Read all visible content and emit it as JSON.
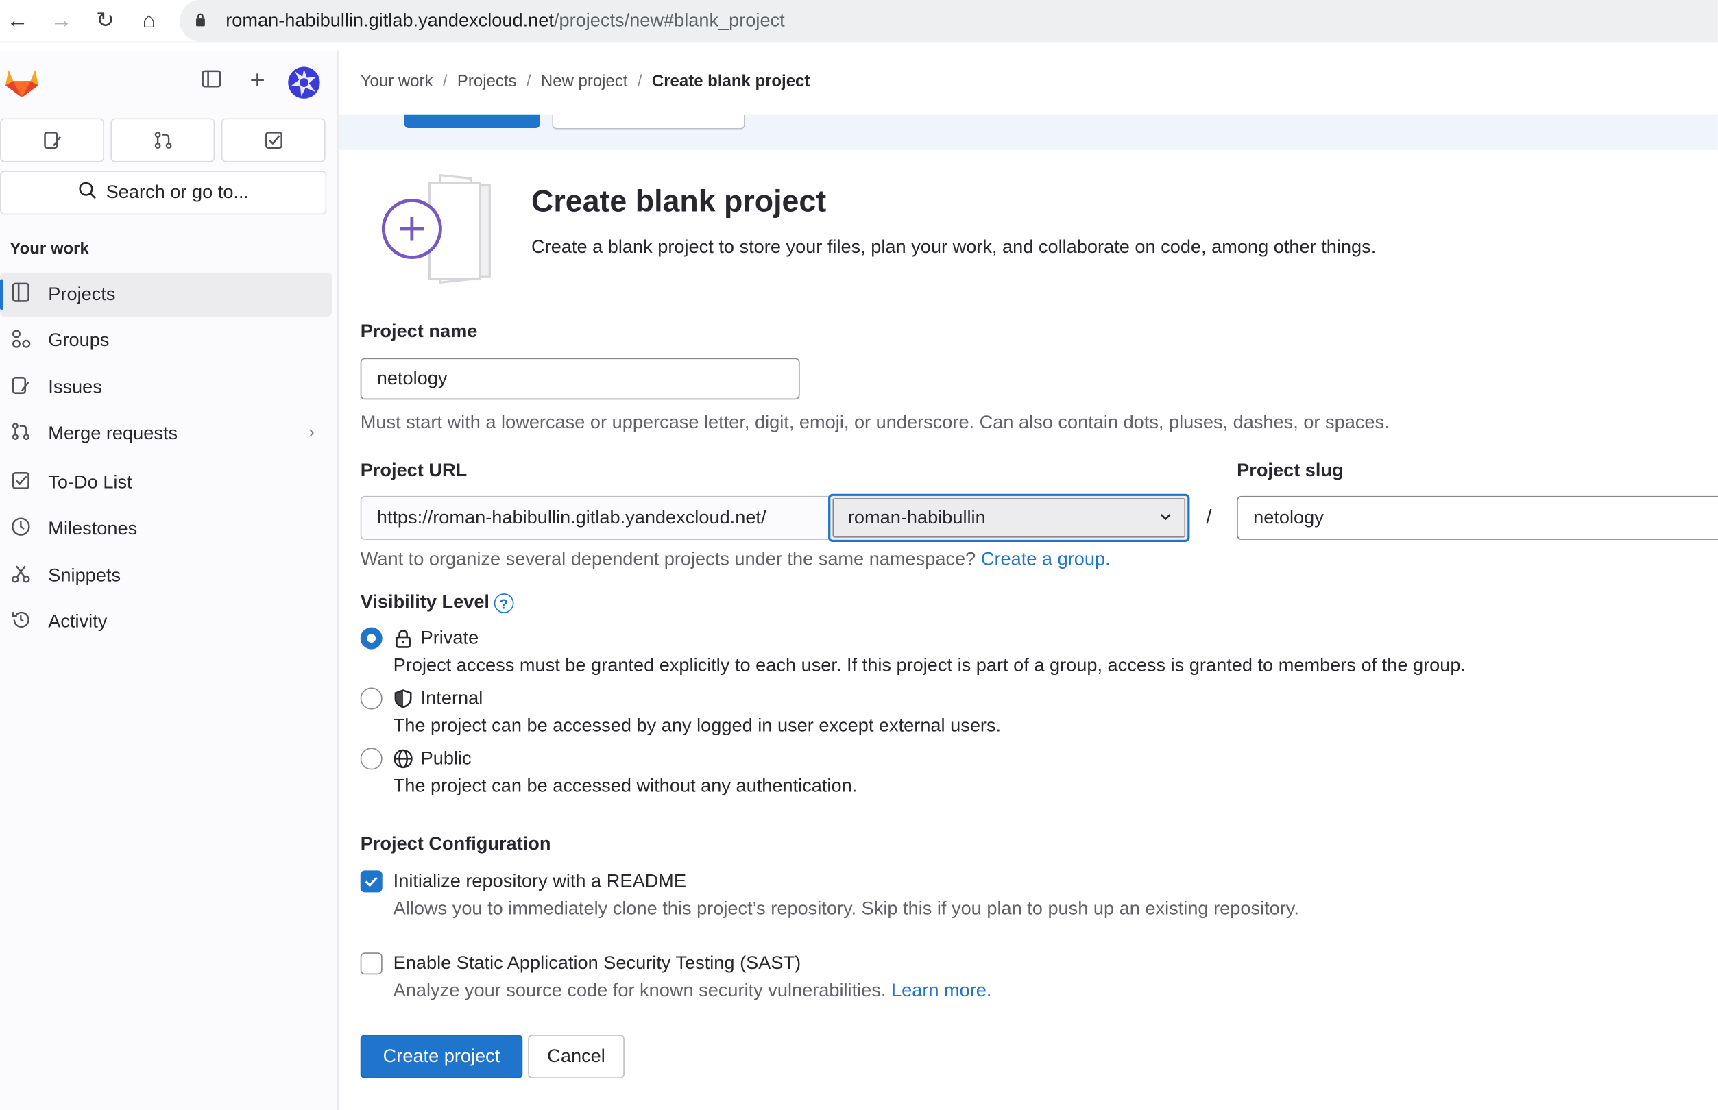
{
  "browser": {
    "url_host": "roman-habibullin.gitlab.yandexcloud.net",
    "url_path": "/projects/new#blank_project"
  },
  "sidebar": {
    "search_label": "Search or go to...",
    "section_title": "Your work",
    "items": [
      {
        "label": "Projects",
        "icon": "project-icon"
      },
      {
        "label": "Groups",
        "icon": "group-icon"
      },
      {
        "label": "Issues",
        "icon": "issues-icon"
      },
      {
        "label": "Merge requests",
        "icon": "merge-request-icon"
      },
      {
        "label": "To-Do List",
        "icon": "todo-icon"
      },
      {
        "label": "Milestones",
        "icon": "milestone-icon"
      },
      {
        "label": "Snippets",
        "icon": "snippet-icon"
      },
      {
        "label": "Activity",
        "icon": "history-icon"
      }
    ]
  },
  "breadcrumb": {
    "items": [
      "Your work",
      "Projects",
      "New project",
      "Create blank project"
    ]
  },
  "header": {
    "title": "Create blank project",
    "description": "Create a blank project to store your files, plan your work, and collaborate on code, among other things."
  },
  "form": {
    "project_name_label": "Project name",
    "project_name_value": "netology",
    "project_name_help": "Must start with a lowercase or uppercase letter, digit, emoji, or underscore. Can also contain dots, pluses, dashes, or spaces.",
    "project_url_label": "Project URL",
    "project_url_prefix": "https://roman-habibullin.gitlab.yandexcloud.net/",
    "namespace_value": "roman-habibullin",
    "slash": "/",
    "project_slug_label": "Project slug",
    "project_slug_value": "netology",
    "namespace_help": "Want to organize several dependent projects under the same namespace?",
    "namespace_help_link": "Create a group.",
    "visibility_label": "Visibility Level",
    "visibility_help_glyph": "?",
    "visibility_options": [
      {
        "label": "Private",
        "desc": "Project access must be granted explicitly to each user. If this project is part of a group, access is granted to members of the group.",
        "checked": true
      },
      {
        "label": "Internal",
        "desc": "The project can be accessed by any logged in user except external users.",
        "checked": false
      },
      {
        "label": "Public",
        "desc": "The project can be accessed without any authentication.",
        "checked": false
      }
    ],
    "config_label": "Project Configuration",
    "readme_label": "Initialize repository with a README",
    "readme_desc": "Allows you to immediately clone this project’s repository. Skip this if you plan to push up an existing repository.",
    "readme_checked": true,
    "sast_label": "Enable Static Application Security Testing (SAST)",
    "sast_desc": "Analyze your source code for known security vulnerabilities.",
    "sast_link": "Learn more.",
    "sast_checked": false
  },
  "buttons": {
    "create": "Create project",
    "cancel": "Cancel"
  },
  "colors": {
    "accent": "#1f75cb",
    "sidebar_bg": "#fbfafd",
    "tanuki_orange": "#e24329"
  }
}
